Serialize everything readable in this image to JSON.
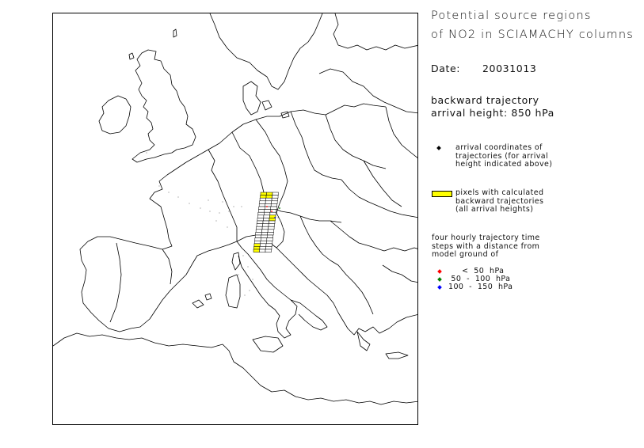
{
  "title": {
    "line1": "Potential source regions",
    "line2": "of NO2 in SCIAMACHY columns"
  },
  "date": {
    "label": "Date:",
    "value": "20031013"
  },
  "trajectory": {
    "line1": "backward trajectory",
    "line2": "arrival height: 850 hPa"
  },
  "legend": {
    "arrival": {
      "color": "#000000",
      "text": "arrival coordinates of\ntrajectories (for arrival\nheight indicated above)"
    },
    "pixels": {
      "color": "#ffff00",
      "text": "pixels with calculated\nbackward trajectories\n(all arrival heights)"
    },
    "steps_heading": "four hourly trajectory time\nsteps with a distance from\nmodel ground of",
    "steps": [
      {
        "color": "#ff0000",
        "label": "     <  50  hPa"
      },
      {
        "color": "#008000",
        "label": " 50  -  100  hPa"
      },
      {
        "color": "#0000ff",
        "label": "100  -  150  hPa"
      }
    ]
  }
}
